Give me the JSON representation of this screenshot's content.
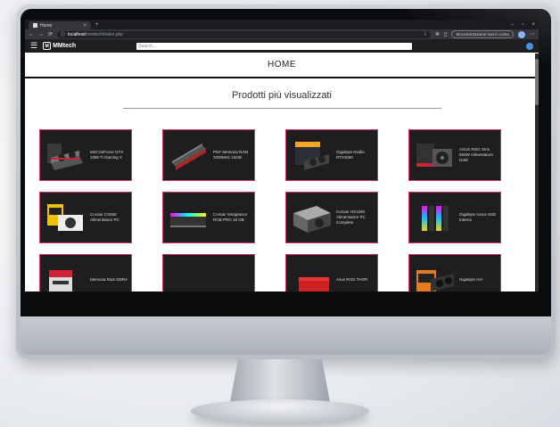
{
  "browser": {
    "tab_title": "Home",
    "tab_close": "×",
    "new_tab": "+",
    "window_controls": [
      "–",
      "▫",
      "×"
    ],
    "nav_icons": [
      "←",
      "→",
      "⟳"
    ],
    "url_host": "localhost",
    "url_path": "/mmtech/index.php",
    "sync_label": "Sincronizzazione non in corso"
  },
  "site": {
    "hamburger": "☰",
    "logo_mark": "M",
    "logo_text": "MMtech",
    "search_placeholder": "Search..."
  },
  "page": {
    "header": "HOME",
    "section_title": "Prodotti più visualizzati"
  },
  "products": [
    {
      "name": "MSI GeForce GTX 1080 Ti Gaming X",
      "icon": "gpu"
    },
    {
      "name": "PNY Memoria RAM 3200MHz 16GB",
      "icon": "ram"
    },
    {
      "name": "Gigabyte Nvidia RTX3060",
      "icon": "gpu-box"
    },
    {
      "name": "ASUS ROG Strix 850W Alimentatore Gold",
      "icon": "psu-box"
    },
    {
      "name": "Corsair CX550 Alimentatore PC",
      "icon": "psu-box-yellow"
    },
    {
      "name": "Corsair Vengeance RGB PRO 16 GB",
      "icon": "ram-rgb"
    },
    {
      "name": "Corsair HX1200 Alimentatore PC Completo",
      "icon": "psu"
    },
    {
      "name": "Gigabyte Aorus SSD Interno",
      "icon": "ssd-rgb"
    },
    {
      "name": "Memoria Ram DDR4",
      "icon": "ram-box"
    },
    {
      "name": "",
      "icon": "empty"
    },
    {
      "name": "Asus ROG THOR",
      "icon": "psu-red"
    },
    {
      "name": "Gigabyte GV-",
      "icon": "gpu-aorus"
    }
  ]
}
